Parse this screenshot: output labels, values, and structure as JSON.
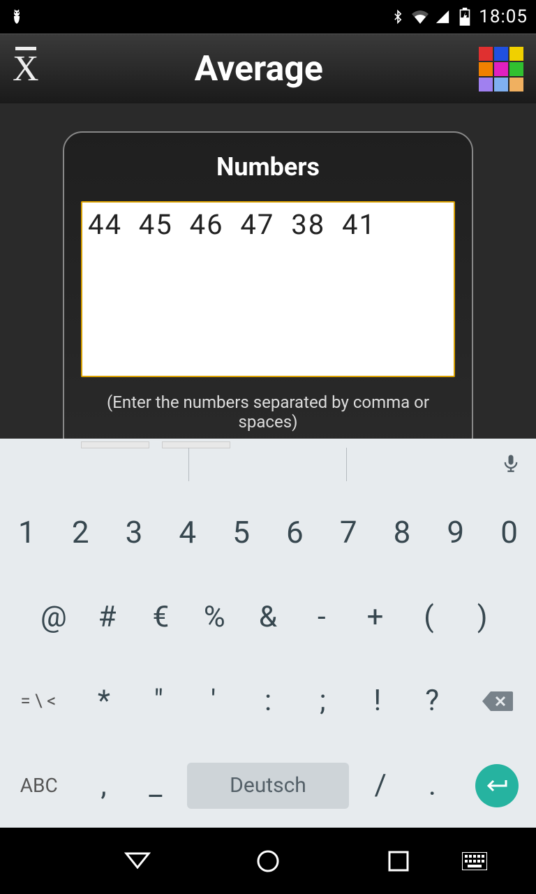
{
  "status": {
    "time": "18:05"
  },
  "header": {
    "title": "Average"
  },
  "card": {
    "title": "Numbers",
    "input_value": "44  45  46  47  38  41",
    "hint": "(Enter the numbers separated by comma or spaces)"
  },
  "keyboard": {
    "row1": [
      "1",
      "2",
      "3",
      "4",
      "5",
      "6",
      "7",
      "8",
      "9",
      "0"
    ],
    "row2": [
      "@",
      "#",
      "€",
      "%",
      "&",
      "-",
      "+",
      "(",
      ")"
    ],
    "row3_left": "= \\ <",
    "row3_mid": [
      "*",
      "\"",
      "'",
      ":",
      ";",
      "!",
      "?"
    ],
    "row4_abc": "ABC",
    "row4_comma": ",",
    "row4_underscore": "_",
    "row4_space": "Deutsch",
    "row4_slash": "/",
    "row4_dot": "."
  }
}
